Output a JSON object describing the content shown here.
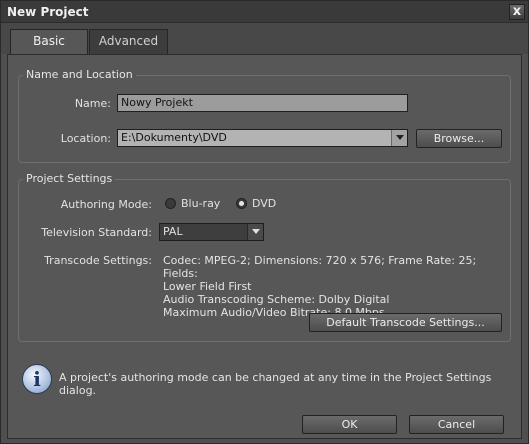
{
  "window": {
    "title": "New Project",
    "close_label": "x"
  },
  "tabs": [
    {
      "label": "Basic"
    },
    {
      "label": "Advanced"
    }
  ],
  "name_location": {
    "group_title": "Name and Location",
    "name_label": "Name:",
    "name_value": "Nowy Projekt",
    "location_label": "Location:",
    "location_value": "E:\\Dokumenty\\DVD",
    "browse_label": "Browse..."
  },
  "project_settings": {
    "group_title": "Project Settings",
    "authoring_label": "Authoring Mode:",
    "authoring_options": [
      {
        "label": "Blu-ray",
        "checked": false
      },
      {
        "label": "DVD",
        "checked": true
      }
    ],
    "tv_label": "Television Standard:",
    "tv_value": "PAL",
    "transcode_label": "Transcode Settings:",
    "transcode_lines": [
      "Codec: MPEG-2; Dimensions: 720 x 576; Frame Rate: 25; Fields:",
      "Lower Field First",
      "Audio Transcoding Scheme: Dolby Digital",
      "Maximum Audio/Video Bitrate: 8.0 Mbps"
    ],
    "default_transcode_label": "Default Transcode Settings..."
  },
  "info": {
    "text": "A project's authoring mode can be changed at any time in the Project Settings dialog.",
    "icon": "info-icon"
  },
  "buttons": {
    "ok": "OK",
    "cancel": "Cancel"
  }
}
